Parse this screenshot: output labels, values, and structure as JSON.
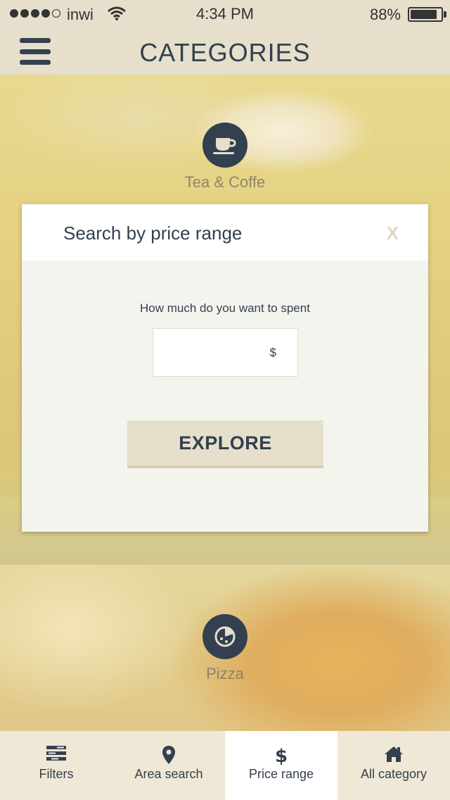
{
  "status_bar": {
    "carrier": "inwi",
    "time": "4:34 PM",
    "battery": "88%",
    "battery_level": 0.88,
    "signal_bars": 4
  },
  "header": {
    "title": "CATEGORIES",
    "menu_icon": "hamburger-icon"
  },
  "categories": [
    {
      "label": "Tea & Coffe",
      "icon": "coffee-cup-icon"
    },
    {
      "label": "Pizza",
      "icon": "pizza-icon"
    }
  ],
  "modal": {
    "title": "Search by price range",
    "close_label": "X",
    "question": "How much do you want to spent",
    "price_value": "",
    "currency": "$",
    "explore_label": "EXPLORE"
  },
  "tabs": [
    {
      "label": "Filters",
      "icon": "filters-icon",
      "active": false
    },
    {
      "label": "Area search",
      "icon": "map-pin-icon",
      "active": false
    },
    {
      "label": "Price range",
      "icon": "dollar-icon",
      "active": true
    },
    {
      "label": "All category",
      "icon": "home-icon",
      "active": false
    }
  ],
  "colors": {
    "primary": "#34404f",
    "beige": "#e5dfcc",
    "accent_close": "#e0d8c2"
  }
}
